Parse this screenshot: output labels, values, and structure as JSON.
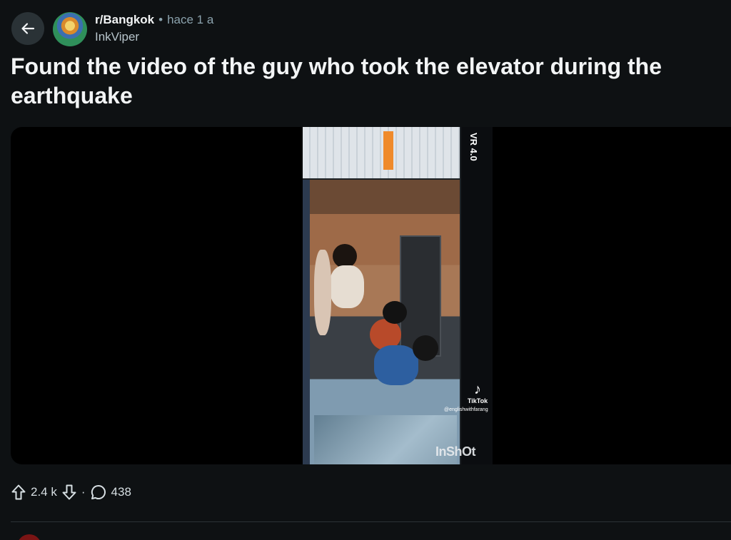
{
  "header": {
    "subreddit": "r/Bangkok",
    "separator": "•",
    "time": "hace 1 a",
    "username": "InkViper"
  },
  "post": {
    "title": "Found the video of the guy who took the elevator during the earthquake"
  },
  "media": {
    "overlay_version": "VR 4.0",
    "watermark_app": "TikTok",
    "watermark_handle": "@englishwithfarang",
    "watermark_editor": "InShOt"
  },
  "actions": {
    "upvotes": "2.4 k",
    "separator": "·",
    "comments": "438"
  },
  "icons": {
    "back": "arrow-left-icon",
    "upvote": "arrow-up-icon",
    "downvote": "arrow-down-icon",
    "comments": "comment-bubble-icon"
  },
  "colors": {
    "background": "#0e1113",
    "button": "#2a3236",
    "muted_text": "#8ba2ad"
  }
}
